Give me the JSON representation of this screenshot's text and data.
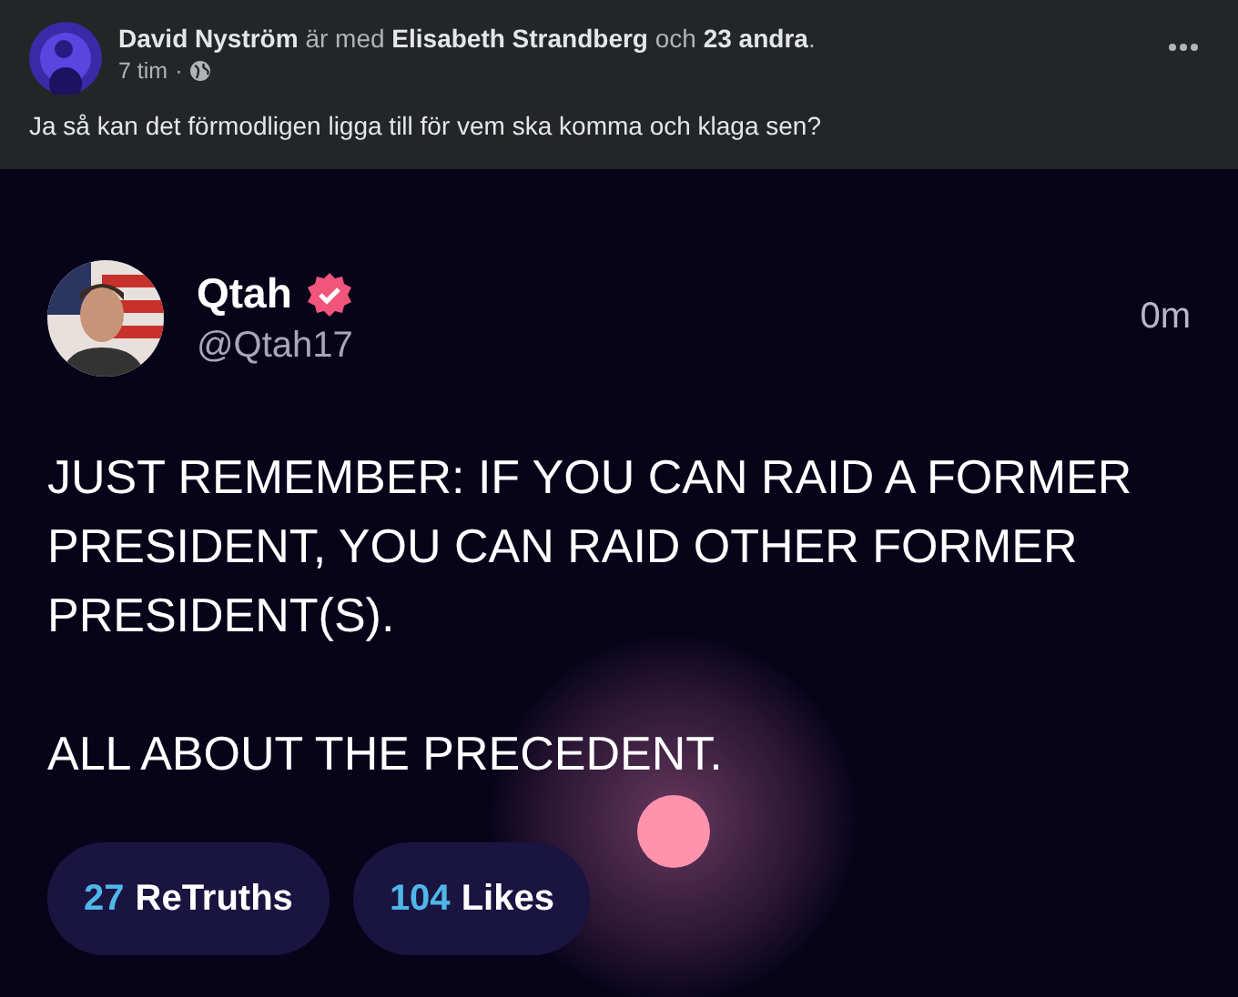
{
  "post": {
    "header": "**David Nyström** är med **Elisabeth Strandberg** och **23 andra**.",
    "time": "7 tim",
    "separator": "·",
    "text": "Ja så kan det förmodligen ligga till för vem ska komma och klaga sen?"
  },
  "shared_image": {
    "name": "Qtah",
    "verified": true,
    "handle": "@Qtah17",
    "age": "0m",
    "text": [
      "JUST REMEMBER: IF YOU CAN RAID A FORMER PRESIDENT, YOU CAN RAID OTHER FORMER PRESIDENT(S).",
      "ALL ABOUT THE PRECEDENT."
    ],
    "stats": [
      {
        "count": "27",
        "label": "ReTruths"
      },
      {
        "count": "104",
        "label": "Likes"
      }
    ]
  }
}
